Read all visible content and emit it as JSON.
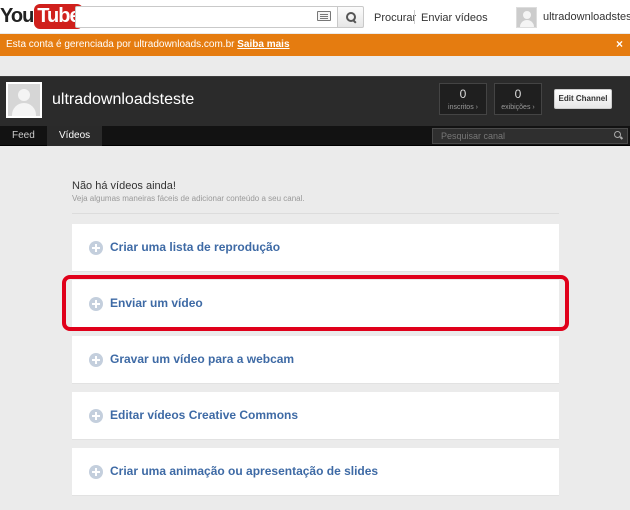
{
  "masthead": {
    "logo_you": "You",
    "logo_tube": "Tube",
    "search": {
      "value": "",
      "placeholder": ""
    },
    "nav": {
      "procurar": "Procurar",
      "enviar_videos": "Enviar vídeos"
    },
    "user": {
      "name": "ultradownloadsteste"
    }
  },
  "alert": {
    "text": "Esta conta é gerenciada por ultradownloads.com.br",
    "link": "Saiba mais",
    "close": "×",
    "color": "#e57c10"
  },
  "channel": {
    "name": "ultradownloadsteste",
    "stats": [
      {
        "value": "0",
        "label": "inscritos ›"
      },
      {
        "value": "0",
        "label": "exibições ›"
      }
    ],
    "edit_button": "Edit Channel"
  },
  "tabs": [
    {
      "label": "Feed",
      "active": false
    },
    {
      "label": "Vídeos",
      "active": true
    }
  ],
  "channel_search": {
    "placeholder": "Pesquisar canal"
  },
  "empty_state": {
    "title": "Não há vídeos ainda!",
    "subtitle": "Veja algumas maneiras fáceis de adicionar conteúdo a seu canal."
  },
  "actions": [
    {
      "label": "Criar uma lista de reprodução",
      "icon": "plus-circle-icon"
    },
    {
      "label": "Enviar um vídeo",
      "icon": "plus-circle-icon",
      "highlighted": true
    },
    {
      "label": "Gravar um vídeo para a webcam",
      "icon": "plus-circle-icon"
    },
    {
      "label": "Editar vídeos Creative Commons",
      "icon": "plus-circle-icon"
    },
    {
      "label": "Criar uma animação ou apresentação de slides",
      "icon": "plus-circle-icon"
    }
  ],
  "colors": {
    "link_blue": "#3e6aa5",
    "highlight_red": "#e0001a",
    "brand_red": "#d0201c"
  }
}
